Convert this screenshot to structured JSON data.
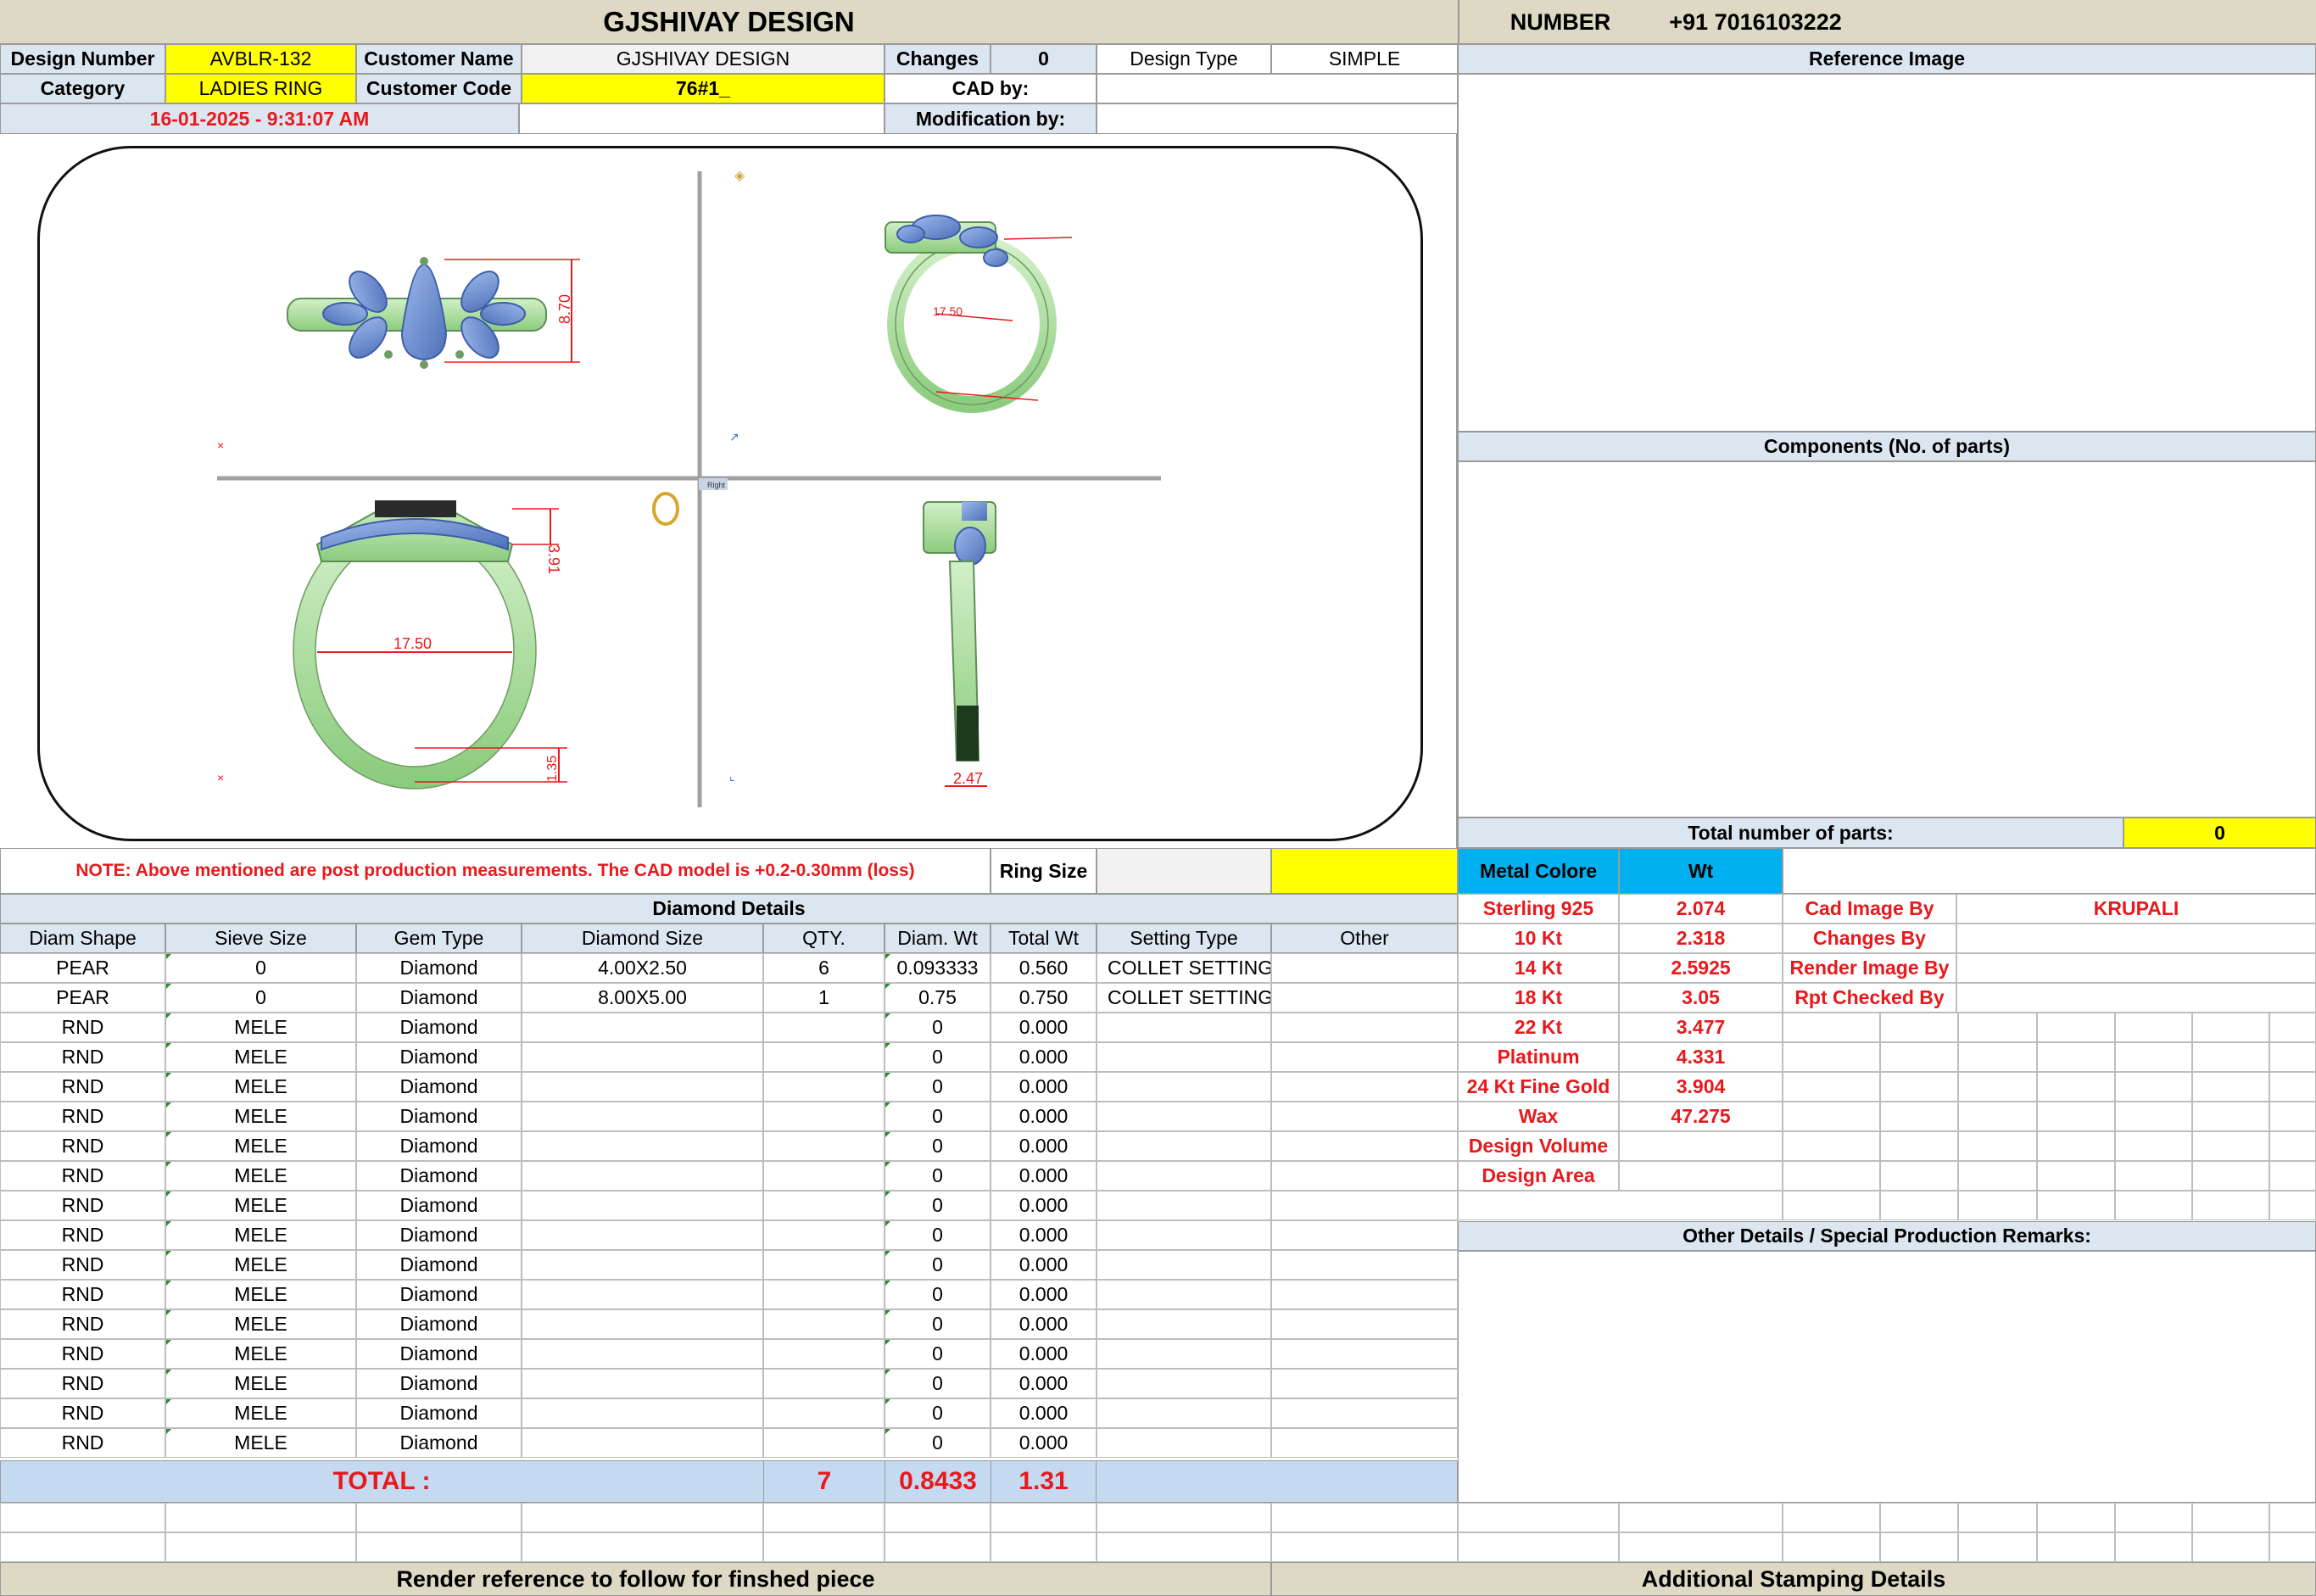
{
  "header": {
    "company": "GJSHIVAY DESIGN",
    "number_label": "NUMBER",
    "number_value": "+91 7016103222"
  },
  "info": {
    "design_number_label": "Design Number",
    "design_number": "AVBLR-132",
    "customer_name_label": "Customer Name",
    "customer_name": "GJSHIVAY DESIGN",
    "changes_label": "Changes",
    "changes": "0",
    "design_type_label": "Design Type",
    "design_type": "SIMPLE",
    "category_label": "Category",
    "category": "LADIES RING",
    "customer_code_label": "Customer Code",
    "customer_code": "76#1_",
    "cad_by_label": "CAD by:",
    "cad_by": "",
    "datetime": "16-01-2025 - 9:31:07 AM",
    "modification_by_label": "Modification by:",
    "modification_by": ""
  },
  "cad": {
    "dim_top_height": "8.70",
    "dim_persp_size": "17.50",
    "dim_front_width": "17.50",
    "dim_front_height": "3.91",
    "dim_front_shank": "1.35",
    "dim_side_width": "2.47",
    "viewport_label": "Right",
    "colors": {
      "metal": "#b5e3a8",
      "metal_shade": "#7fbf72",
      "stone": "#6f93d6",
      "dim": "#e8191c"
    }
  },
  "right_panel": {
    "reference_image_label": "Reference Image",
    "components_label": "Components (No. of parts)",
    "total_parts_label": "Total number of parts:",
    "total_parts": "0"
  },
  "note": {
    "text": "NOTE: Above mentioned are post production measurements. The CAD model is +0.2-0.30mm (loss)",
    "ring_size_label": "Ring Size",
    "ring_size": ""
  },
  "metal": {
    "header_label": "Metal Colore",
    "header_wt": "Wt",
    "rows": [
      {
        "name": "Sterling 925",
        "wt": "2.074"
      },
      {
        "name": "10 Kt",
        "wt": "2.318"
      },
      {
        "name": "14 Kt",
        "wt": "2.5925"
      },
      {
        "name": "18 Kt",
        "wt": "3.05"
      },
      {
        "name": "22 Kt",
        "wt": "3.477"
      },
      {
        "name": "Platinum",
        "wt": "4.331"
      },
      {
        "name": "24 Kt Fine Gold",
        "wt": "3.904"
      },
      {
        "name": "Wax",
        "wt": "47.275"
      },
      {
        "name": "Design Volume",
        "wt": ""
      },
      {
        "name": "Design Area",
        "wt": ""
      }
    ]
  },
  "credits": [
    {
      "label": "Cad Image By",
      "value": "KRUPALI"
    },
    {
      "label": "Changes By",
      "value": ""
    },
    {
      "label": "Render Image By",
      "value": ""
    },
    {
      "label": "Rpt Checked By",
      "value": ""
    }
  ],
  "diamond": {
    "title": "Diamond Details",
    "headers": [
      "Diam Shape",
      "Sieve Size",
      "Gem Type",
      "Diamond Size",
      "QTY.",
      "Diam. Wt",
      "Total Wt",
      "Setting Type",
      "Other"
    ],
    "rows": [
      [
        "PEAR",
        "0",
        "Diamond",
        "4.00X2.50",
        "6",
        "0.093333",
        "0.560",
        "COLLET SETTING",
        ""
      ],
      [
        "PEAR",
        "0",
        "Diamond",
        "8.00X5.00",
        "1",
        "0.75",
        "0.750",
        "COLLET SETTING",
        ""
      ],
      [
        "RND",
        "MELE",
        "Diamond",
        "",
        "",
        "0",
        "0.000",
        "",
        ""
      ],
      [
        "RND",
        "MELE",
        "Diamond",
        "",
        "",
        "0",
        "0.000",
        "",
        ""
      ],
      [
        "RND",
        "MELE",
        "Diamond",
        "",
        "",
        "0",
        "0.000",
        "",
        ""
      ],
      [
        "RND",
        "MELE",
        "Diamond",
        "",
        "",
        "0",
        "0.000",
        "",
        ""
      ],
      [
        "RND",
        "MELE",
        "Diamond",
        "",
        "",
        "0",
        "0.000",
        "",
        ""
      ],
      [
        "RND",
        "MELE",
        "Diamond",
        "",
        "",
        "0",
        "0.000",
        "",
        ""
      ],
      [
        "RND",
        "MELE",
        "Diamond",
        "",
        "",
        "0",
        "0.000",
        "",
        ""
      ],
      [
        "RND",
        "MELE",
        "Diamond",
        "",
        "",
        "0",
        "0.000",
        "",
        ""
      ],
      [
        "RND",
        "MELE",
        "Diamond",
        "",
        "",
        "0",
        "0.000",
        "",
        ""
      ],
      [
        "RND",
        "MELE",
        "Diamond",
        "",
        "",
        "0",
        "0.000",
        "",
        ""
      ],
      [
        "RND",
        "MELE",
        "Diamond",
        "",
        "",
        "0",
        "0.000",
        "",
        ""
      ],
      [
        "RND",
        "MELE",
        "Diamond",
        "",
        "",
        "0",
        "0.000",
        "",
        ""
      ],
      [
        "RND",
        "MELE",
        "Diamond",
        "",
        "",
        "0",
        "0.000",
        "",
        ""
      ],
      [
        "RND",
        "MELE",
        "Diamond",
        "",
        "",
        "0",
        "0.000",
        "",
        ""
      ],
      [
        "RND",
        "MELE",
        "Diamond",
        "",
        "",
        "0",
        "0.000",
        "",
        ""
      ]
    ],
    "total_label": "TOTAL :",
    "total_qty": "7",
    "total_diam_wt": "0.8433",
    "total_wt": "1.31"
  },
  "remarks_label": "Other Details / Special Production Remarks:",
  "footer": {
    "render_reference": "Render reference to follow for finshed piece",
    "stamping": "Additional Stamping Details"
  }
}
